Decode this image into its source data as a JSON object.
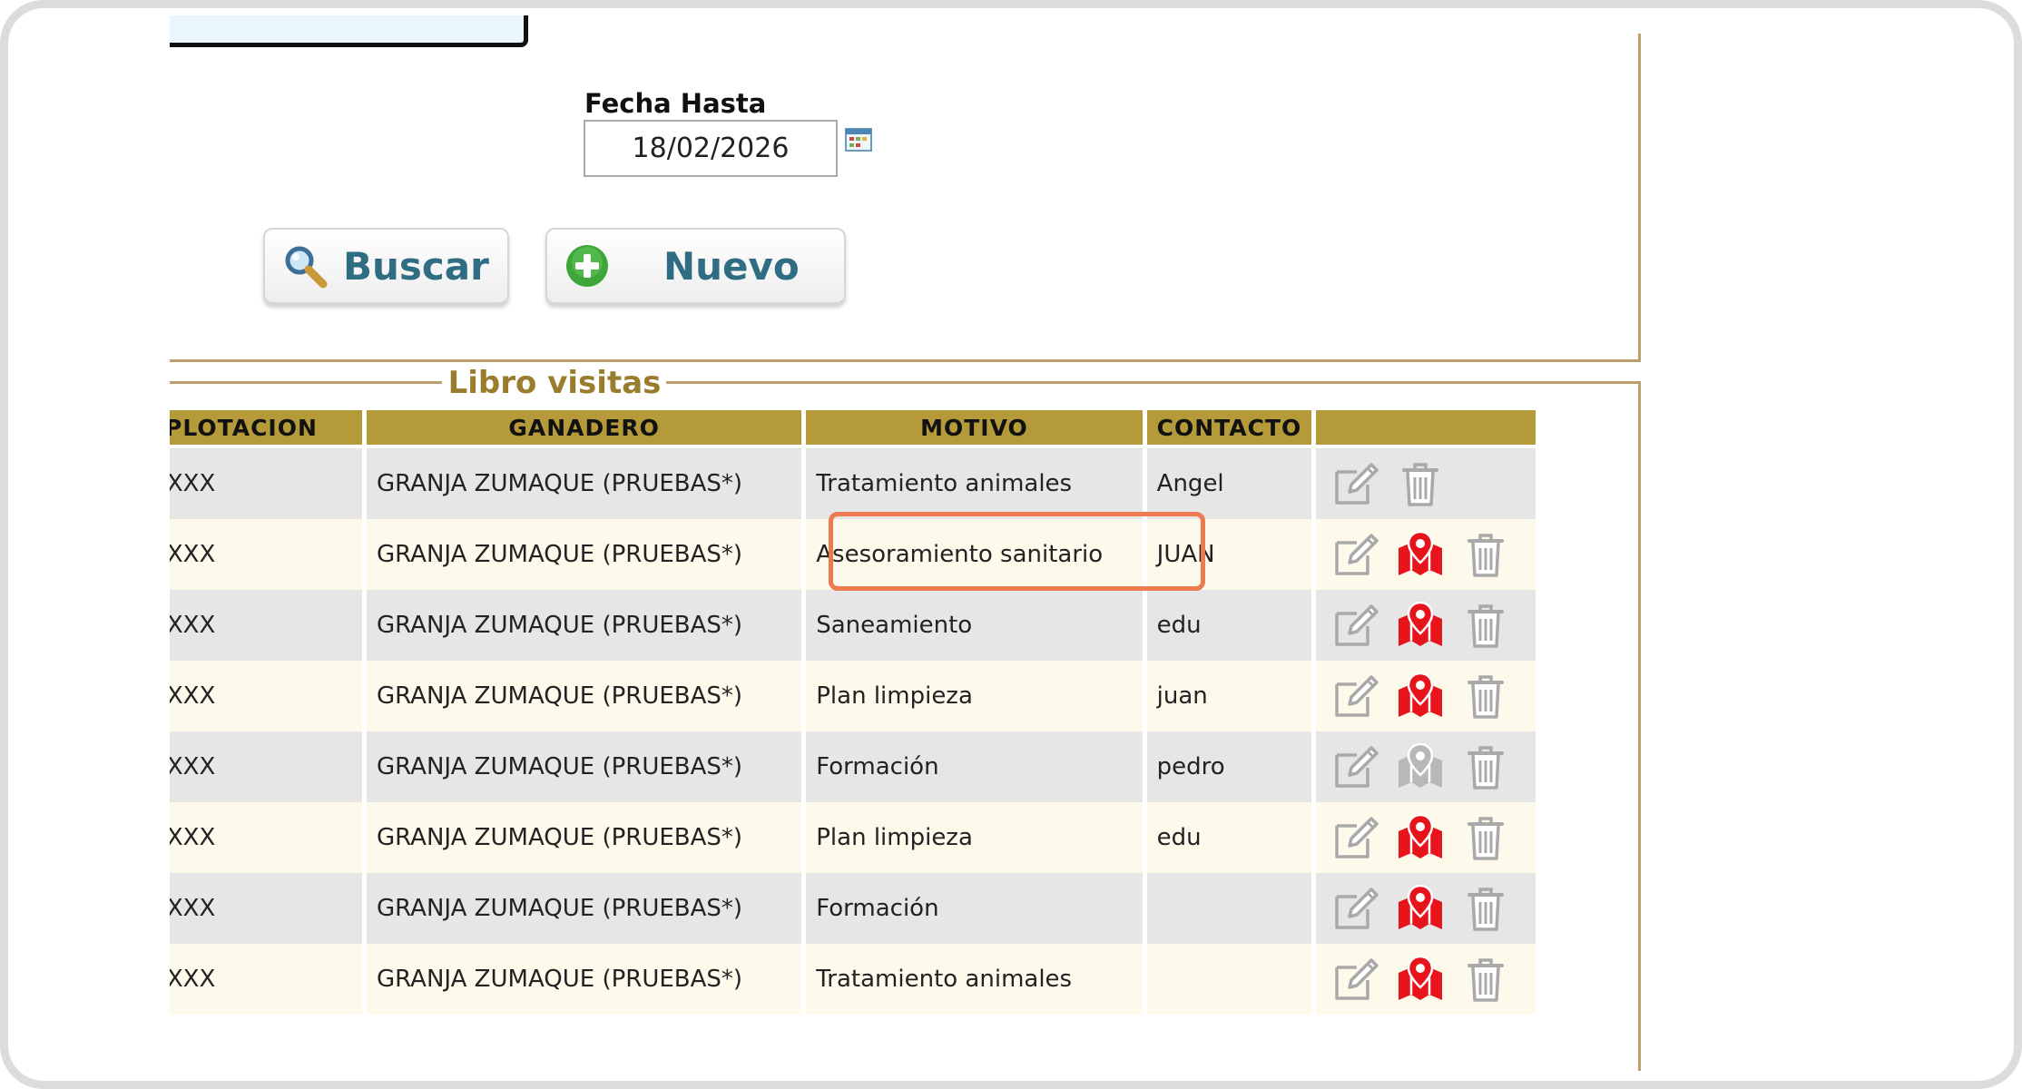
{
  "filters": {
    "fecha_hasta_label": "Fecha Hasta",
    "fecha_hasta_value": "18/02/2026"
  },
  "buttons": {
    "buscar_label": "Buscar",
    "nuevo_label": "Nuevo"
  },
  "section": {
    "legend": "Libro visitas"
  },
  "table": {
    "headers": [
      "PLOTACION",
      "GANADERO",
      "MOTIVO",
      "CONTACTO",
      ""
    ],
    "rows": [
      {
        "explotacion": "XXXXXXXXX",
        "ganadero": "GRANJA ZUMAQUE (PRUEBAS*)",
        "motivo": "Tratamiento animales",
        "contacto": "Angel",
        "map_state": "none"
      },
      {
        "explotacion": "XXXXXXXXX",
        "ganadero": "GRANJA ZUMAQUE (PRUEBAS*)",
        "motivo": "Asesoramiento sanitario",
        "contacto": "JUAN",
        "map_state": "active"
      },
      {
        "explotacion": "XXXXXXXXX",
        "ganadero": "GRANJA ZUMAQUE (PRUEBAS*)",
        "motivo": "Saneamiento",
        "contacto": "edu",
        "map_state": "active"
      },
      {
        "explotacion": "XXXXXXXXX",
        "ganadero": "GRANJA ZUMAQUE (PRUEBAS*)",
        "motivo": "Plan limpieza",
        "contacto": "juan",
        "map_state": "active"
      },
      {
        "explotacion": "XXXXXXXXX",
        "ganadero": "GRANJA ZUMAQUE (PRUEBAS*)",
        "motivo": "Formación",
        "contacto": "pedro",
        "map_state": "inactive"
      },
      {
        "explotacion": "XXXXXXXXX",
        "ganadero": "GRANJA ZUMAQUE (PRUEBAS*)",
        "motivo": "Plan limpieza",
        "contacto": "edu",
        "map_state": "active"
      },
      {
        "explotacion": "XXXXXXXXX",
        "ganadero": "GRANJA ZUMAQUE (PRUEBAS*)",
        "motivo": "Formación",
        "contacto": "",
        "map_state": "active"
      },
      {
        "explotacion": "XXXXXXXXX",
        "ganadero": "GRANJA ZUMAQUE (PRUEBAS*)",
        "motivo": "Tratamiento animales",
        "contacto": "",
        "map_state": "active"
      }
    ],
    "action_icons": [
      "edit-icon",
      "map-icon",
      "trash-icon"
    ]
  },
  "highlight": {
    "target": "motivo cell, row 2",
    "color": "#ee7a4f"
  },
  "colors": {
    "header_bg": "#b59a3a",
    "border_gold": "#b9a06a",
    "legend_text": "#9a7d2c",
    "row_odd": "#e6e6e6",
    "row_even": "#fdfaeb",
    "button_text": "#2f6d83",
    "map_active": "#e8141c",
    "map_inactive": "#b8b8b8"
  }
}
